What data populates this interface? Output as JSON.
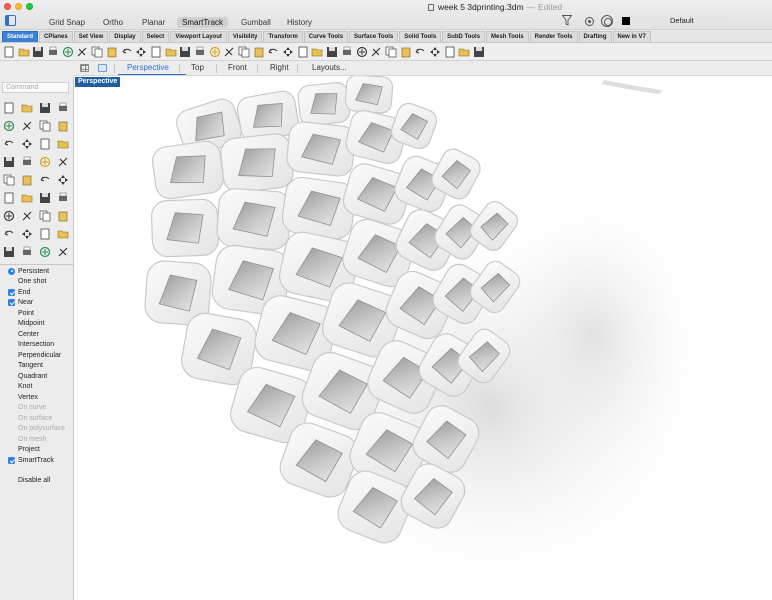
{
  "window": {
    "title": "week 5 3dprinting.3dm",
    "separator": "—",
    "status": "Edited"
  },
  "modes": [
    {
      "label": "Grid Snap",
      "active": false
    },
    {
      "label": "Ortho",
      "active": false
    },
    {
      "label": "Planar",
      "active": false
    },
    {
      "label": "SmartTrack",
      "active": true
    },
    {
      "label": "Gumball",
      "active": false
    },
    {
      "label": "History",
      "active": false
    }
  ],
  "layer": {
    "current": "Default",
    "swatch_color": "#000000"
  },
  "toolbar_tabs": [
    "Standard",
    "CPlanes",
    "Set View",
    "Display",
    "Select",
    "Viewport Layout",
    "Visibility",
    "Transform",
    "Curve Tools",
    "Surface Tools",
    "Solid Tools",
    "SubD Tools",
    "Mesh Tools",
    "Render Tools",
    "Drafting",
    "New in V7"
  ],
  "active_toolbar_tab": "Standard",
  "toolbar_icons": [
    "new-file-icon",
    "open-file-icon",
    "save-icon",
    "print-icon",
    "import-icon",
    "cut-icon",
    "copy-icon",
    "paste-icon",
    "undo-icon",
    "pan-icon",
    "rotate-view-icon",
    "zoom-icon",
    "zoom-window-icon",
    "zoom-extents-icon",
    "zoom-selected-icon",
    "four-viewports-icon",
    "grid-icon",
    "layers-icon",
    "properties-icon",
    "select-icon",
    "light-icon",
    "lock-icon",
    "hide-icon",
    "color-wheel-icon",
    "render-icon",
    "materials-icon",
    "environment-icon",
    "sphere-icon",
    "filter-icon",
    "dimension-icon",
    "layout-icon",
    "plugin-icon",
    "help-icon"
  ],
  "viewport_tabs": [
    {
      "label": "Perspective",
      "active": true
    },
    {
      "label": "Top",
      "active": false
    },
    {
      "label": "Front",
      "active": false
    },
    {
      "label": "Right",
      "active": false
    },
    {
      "label": "Layouts...",
      "active": false
    }
  ],
  "command": {
    "placeholder": "Command"
  },
  "viewport": {
    "title": "Perspective",
    "title_bg": "#1f5fa0"
  },
  "osnap": {
    "mode_options": [
      {
        "label": "Persistent",
        "selected": true
      },
      {
        "label": "One shot",
        "selected": false
      }
    ],
    "items": [
      {
        "label": "End",
        "checked": true,
        "enabled": true
      },
      {
        "label": "Near",
        "checked": true,
        "enabled": true
      },
      {
        "label": "Point",
        "checked": false,
        "enabled": true
      },
      {
        "label": "Midpoint",
        "checked": false,
        "enabled": true
      },
      {
        "label": "Center",
        "checked": false,
        "enabled": true
      },
      {
        "label": "Intersection",
        "checked": false,
        "enabled": true
      },
      {
        "label": "Perpendicular",
        "checked": false,
        "enabled": true
      },
      {
        "label": "Tangent",
        "checked": false,
        "enabled": true
      },
      {
        "label": "Quadrant",
        "checked": false,
        "enabled": true
      },
      {
        "label": "Knot",
        "checked": false,
        "enabled": true
      },
      {
        "label": "Vertex",
        "checked": false,
        "enabled": true
      },
      {
        "label": "On curve",
        "checked": false,
        "enabled": false
      },
      {
        "label": "On surface",
        "checked": false,
        "enabled": false
      },
      {
        "label": "On polysurface",
        "checked": false,
        "enabled": false
      },
      {
        "label": "On mesh",
        "checked": false,
        "enabled": false
      },
      {
        "label": "Project",
        "checked": false,
        "enabled": true
      },
      {
        "label": "SmartTrack",
        "checked": true,
        "enabled": true
      }
    ],
    "disable_all": "Disable all"
  },
  "colors": {
    "accent": "#2a6fdb",
    "checkbox": "#2f7fe6",
    "tab_active": "#3b82d6"
  }
}
